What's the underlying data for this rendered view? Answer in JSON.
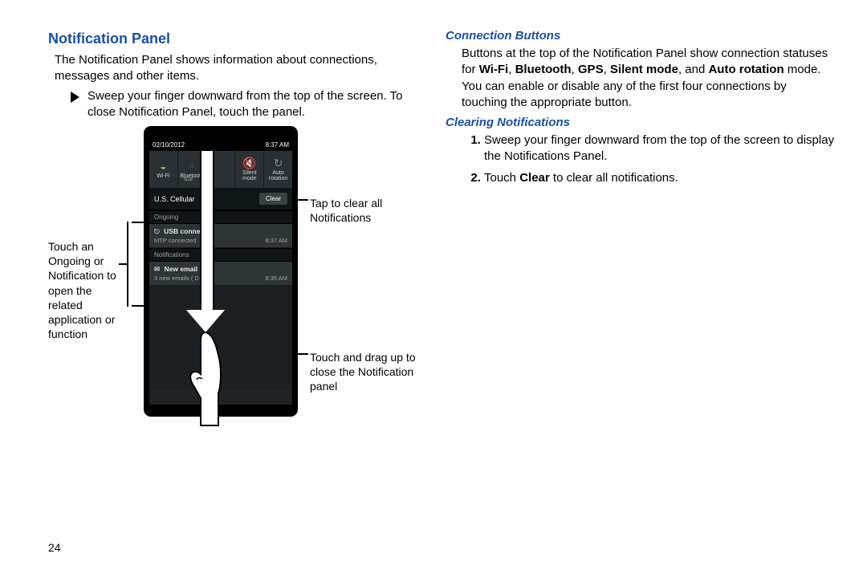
{
  "page_number": "24",
  "left": {
    "heading": "Notification Panel",
    "intro": "The Notification Panel shows information about connections, messages and other items.",
    "bullet": "Sweep your finger downward from the top of the screen. To close Notification Panel, touch the panel.",
    "callout_left": "Touch an Ongoing or Notification to open the related application or function",
    "callout_right_1": "Tap to clear all Notifications",
    "callout_right_2": "Touch and drag up to close the Notification panel",
    "phone": {
      "status_date": "02/10/2012",
      "status_time": "8:37 AM",
      "qs": [
        {
          "label": "Wi-Fi",
          "icon": "wifi",
          "on": true
        },
        {
          "label": "Bluetooth",
          "icon": "bt",
          "on": false
        },
        {
          "label": "",
          "icon": "",
          "on": false
        },
        {
          "label": "Silent mode",
          "icon": "silent",
          "on": false
        },
        {
          "label": "Auto rotation",
          "icon": "rotate",
          "on": false
        }
      ],
      "carrier": "U.S. Cellular",
      "clear_label": "Clear",
      "ongoing_label": "Ongoing",
      "ongoing": {
        "title": "USB connected",
        "sub": "MTP connected",
        "time": "8:37 AM"
      },
      "notif_label": "Notifications",
      "notif": {
        "title": "New email",
        "sub": "3 new emails ( D… )e",
        "time": "8:35 AM"
      }
    }
  },
  "right": {
    "heading1": "Connection Buttons",
    "para1_a": "Buttons at the top of the Notification Panel show connection statuses for ",
    "para1_b1": "Wi-Fi",
    "para1_b2": "Bluetooth",
    "para1_b3": "GPS",
    "para1_b4": "Silent mode",
    "para1_b5": "Auto rotation",
    "para1_c": " mode. You can enable or disable any of the first four connections by touching the appropriate button.",
    "heading2": "Clearing Notifications",
    "step1": "Sweep your finger downward from the top of the screen to display the Notifications Panel.",
    "step2_a": "Touch ",
    "step2_bold": "Clear",
    "step2_b": " to clear all notifications."
  }
}
